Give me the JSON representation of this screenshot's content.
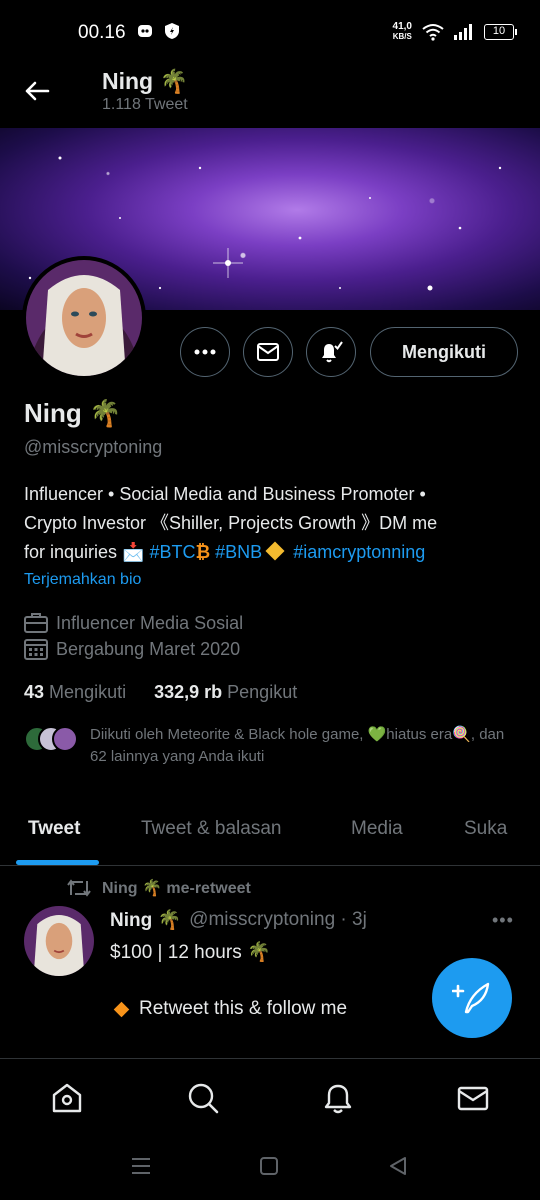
{
  "status_bar": {
    "time": "00.16",
    "speed_value": "41,0",
    "speed_unit": "KB/S",
    "battery": "10"
  },
  "header": {
    "name": "Ning 🌴",
    "tweet_count": "1.118 Tweet"
  },
  "profile": {
    "name": "Ning 🌴",
    "handle": "@misscryptoning",
    "follow_label": "Mengikuti",
    "bio_line1": "Influencer • Social Media and Business Promoter •",
    "bio_line2": "Crypto Investor 《Shiller, Projects Growth 》DM me",
    "bio_line3_prefix": "for inquiries 📩 ",
    "tag_btc": "#BTC",
    "tag_bnb": "#BNB",
    "tag_iam": "#iamcryptonning",
    "translate_bio": "Terjemahkan bio",
    "category": "Influencer Media Sosial",
    "joined": "Bergabung Maret 2020",
    "following_count": "43",
    "following_label": "Mengikuti",
    "followers_count": "332,9 rb",
    "followers_label": "Pengikut",
    "followed_by": "Diikuti oleh Meteorite & Black hole game, 💚hiatus era🍭, dan 62 lainnya yang Anda ikuti"
  },
  "tabs": [
    {
      "label": "Tweet"
    },
    {
      "label": "Tweet & balasan"
    },
    {
      "label": "Media"
    },
    {
      "label": "Suka"
    }
  ],
  "tweet": {
    "retweet_label": "Ning 🌴 me-retweet",
    "author": "Ning 🌴",
    "handle_time": "@misscryptoning · 3j",
    "more": "•••",
    "line1": "$100 | 12 hours 🌴",
    "line2": "Retweet this & follow me"
  },
  "colors": {
    "accent": "#1d9bf0",
    "background": "#000000",
    "muted": "#71767b",
    "text": "#e7e9ea"
  }
}
